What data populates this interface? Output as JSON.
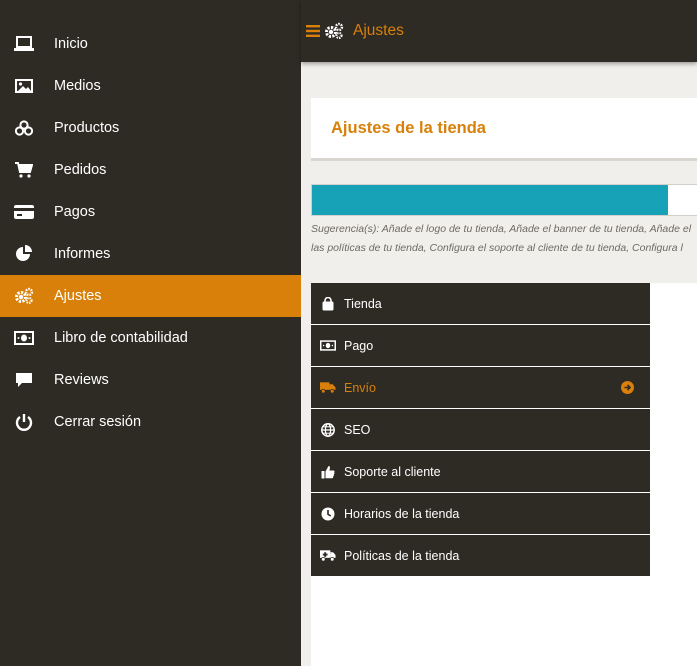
{
  "sidebar": {
    "items": [
      {
        "label": "Inicio",
        "icon": "laptop-icon"
      },
      {
        "label": "Medios",
        "icon": "image-icon"
      },
      {
        "label": "Productos",
        "icon": "cubes-icon"
      },
      {
        "label": "Pedidos",
        "icon": "cart-icon"
      },
      {
        "label": "Pagos",
        "icon": "credit-card-icon"
      },
      {
        "label": "Informes",
        "icon": "pie-chart-icon"
      },
      {
        "label": "Ajustes",
        "icon": "gears-icon",
        "active": true
      },
      {
        "label": "Libro de contabilidad",
        "icon": "money-icon"
      },
      {
        "label": "Reviews",
        "icon": "comment-icon"
      },
      {
        "label": "Cerrar sesión",
        "icon": "power-icon"
      }
    ]
  },
  "topbar": {
    "title": "Ajustes"
  },
  "main": {
    "heading": "Ajustes de la tienda",
    "progress_fraction": 0.925,
    "suggestion_line1": "Sugerencia(s): Añade el logo de tu tienda, Añade el banner de tu tienda, Añade el",
    "suggestion_line2": "las políticas de tu tienda, Configura el soporte al cliente de tu tienda, Configura l",
    "settings_menu": [
      {
        "label": "Tienda",
        "icon": "shopping-bag-icon"
      },
      {
        "label": "Pago",
        "icon": "money-icon"
      },
      {
        "label": "Envío",
        "icon": "truck-icon",
        "active": true
      },
      {
        "label": "SEO",
        "icon": "globe-icon"
      },
      {
        "label": "Soporte al cliente",
        "icon": "thumbs-up-icon"
      },
      {
        "label": "Horarios de la tienda",
        "icon": "clock-icon"
      },
      {
        "label": "Políticas de la tienda",
        "icon": "ambulance-icon"
      }
    ]
  },
  "colors": {
    "accent": "#d8800a",
    "dark": "#2e2a24",
    "progress": "#17a2b8",
    "background": "#f1efeb"
  }
}
